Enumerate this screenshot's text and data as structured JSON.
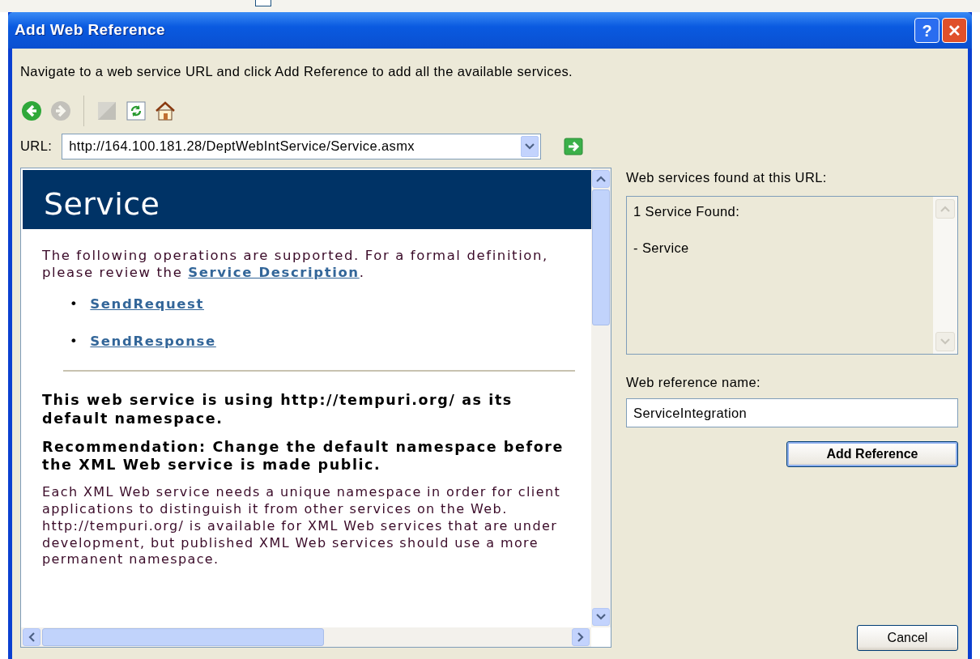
{
  "window": {
    "title": "Add Web Reference"
  },
  "title_buttons": [
    {
      "kind": "help",
      "label": "?"
    },
    {
      "kind": "close",
      "label": "✕"
    }
  ],
  "instructions": "Navigate to a web service URL and click Add Reference to add all the available services.",
  "toolbar": [
    {
      "kind": "back",
      "disabled": false
    },
    {
      "kind": "forward",
      "disabled": true
    },
    {
      "kind": "stop",
      "disabled": true
    },
    {
      "kind": "refresh",
      "disabled": false
    },
    {
      "kind": "home",
      "disabled": false
    }
  ],
  "url": {
    "label": "URL:",
    "value": "http://164.100.181.28/DeptWebIntService/Service.asmx"
  },
  "browser": {
    "heading": "Service",
    "intro": "The following operations are supported. For a formal definition, please review the ",
    "intro_link": "Service Description",
    "intro_end": ".",
    "operations": [
      {
        "bullet": "•",
        "label": "SendRequest"
      },
      {
        "bullet": "•",
        "label": "SendResponse"
      }
    ],
    "notice": "This web service is using http://tempuri.org/ as its default namespace.",
    "recommendation": "Recommendation: Change the default namespace before the XML Web service is made public.",
    "body": "Each XML Web service needs a unique namespace in order for client applications to distinguish it from other services on the Web. http://tempuri.org/ is available for XML Web services that are under development, but published XML Web services should use a more permanent namespace."
  },
  "services": {
    "label": "Web services found at this URL:",
    "lines": [
      "1 Service Found:",
      "- Service"
    ]
  },
  "reference_name": {
    "label": "Web reference name:",
    "value": "ServiceIntegration"
  },
  "buttons": [
    {
      "kind": "add",
      "label": "Add Reference"
    },
    {
      "kind": "cancel",
      "label": "Cancel"
    }
  ]
}
